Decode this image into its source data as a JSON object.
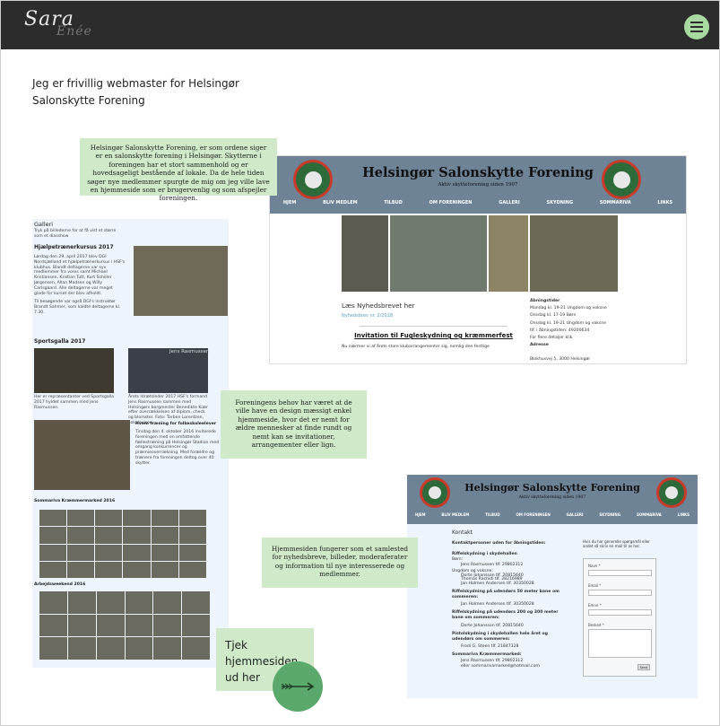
{
  "brand": {
    "logo_text": "Sara",
    "logo_sub": "Enée"
  },
  "intro": {
    "text": "Jeg er frivillig webmaster for Helsingør Salonskytte Forening"
  },
  "notes": {
    "note1": "Helsingør Salonskytte Forening, er som ordene siger er en salonskytte forening i Helsingør. Skytterne i foreningen har et stort sammenhold og er hovedsageligt bestående af lokale. Da de hele tiden søger nye medlemmer spurgte de mig om jeg ville lave en hjemmeside som er brugervenlig og som afspejler foreningen.",
    "note2": "Foreningens behov har været at de ville have en design mæssigt enkel hjemmeside, hvor det er nemt for ældre mennesker at finde rundt og nemt kan se invitationer, arrangementer eller lign.",
    "note3": "Hjemmesiden fungerer som et samlested for nyhedsbreve, billeder, moderaferater og information til nye interesserede og medlemmer."
  },
  "cta": {
    "label": "Tjek hjemmesiden ud her"
  },
  "site": {
    "title": "Helsingør Salonskytte Forening",
    "subtitle": "Aktiv skytteforening siden 1907",
    "nav": [
      "HJEM",
      "BLIV MEDLEM",
      "TILBUD",
      "OM FORENINGEN",
      "GALLERI",
      "SKYDNING",
      "SOMMARIVA",
      "LINKS"
    ]
  },
  "home": {
    "newsletter_heading": "Læs Nyhedsbrevet her",
    "newsletter_link": "Nyhedsbrev nr. 2/2018",
    "invitation_title": "Invitation til Fugleskydning og kræmmerfest",
    "invitation_text": "Nu nærmer vi af årets store klubarrangementer sig, nemlig den festlige",
    "hours": [
      "Åbningstider",
      "Mandag kl. 19-21  Ungdom og voksne",
      "Onsdag  kl. 17-19  Børn",
      "Onsdag  kl. 19-21  Ungdom og voksne",
      "tlf. i åbningstiden: 49200634",
      "For flere detaljer klik",
      "Adresse",
      "Blokhusvej 5, 3000 Helsingør"
    ]
  },
  "gallery": {
    "heading": "Galleri",
    "intro": "Tryk på billederne for at få vist et større som et diasshow",
    "section1": "Hjælpetrænerkursus 2017",
    "section1_text": "Lørdag den 29. april 2017 blev DGI Nordsjælland et hjælpetrænerkursus i HSF's klubhus. Blandt deltagerne var syv medlemmer fra vores samt Michael Kristiansen, Kristian Tutt, Kurt Schiller Jørgensen, Allan Madsen og Willy Carlsgaard. Alle deltagerne var meget glade for kurset der blev afholdt.",
    "section1_text2": "Til besøgende var også DGI's instruktør Brandt Sahmer, som kaldte deltagerne kl. 7.30.",
    "section2": "Sportsgalla 2017",
    "caption_a": "Her er repræsentanter ved Sportsgalla 2017 hyldet sammen med Jens Rasmussen.",
    "caption_b": "Jens Rasmussen",
    "caption_b_text": "Årets Idrætsleder 2017 HSF's formand Jens Rasmussen sammen med Helsingørs borgmester Benedikte Kiær efter overrækkelsen af diplom, check og blomster. Foto: Torben Lorentzen, Lokalavisen.",
    "section3": "Hvem træning for folkeskoleelever",
    "section3_text": "Tirsdag den 4. oktober 2016 inviterede foreningen med en omfattende fællestræning på Helsingør Stadion med et omgang konkurrencer og præmieoverrækning. Med forældre og trænere fra foreningen deltog over 40 skytter.",
    "section4": "Sommariva Kræmmermarked 2016",
    "section5": "Arbejdsweekend 2016"
  },
  "contact": {
    "heading": "Kontakt",
    "people_heading": "Kontaktpersoner uden for åbningstiden:",
    "lines": [
      "Riffelskydning i skydehallen",
      "Børn:",
      "Jens Rasmussen tlf. 29802312",
      "Ungdom og voksne:",
      "Dorte Johansson tlf. 20815640",
      "Thomas Rachidi tlf. 28216989",
      "Jan Holmen Andersen tlf. 30350028",
      "Riffelskydning på udendørs 50 meter bane om sommeren:",
      "Jan Holmen Andersen tlf. 30350028",
      "Riffelskydning på udendørs 200 og 300 meter bane om sommeren:",
      "Dorte Johansson tlf. 20815640",
      "Pistolskydning i skydehallen hele året og udendørs om sommeren:",
      "Frodi G. Steen tlf. 21847328",
      "Sommariva Kræmmermarked:",
      "Jens Rasmussen tlf. 29802312",
      "eller sommarivamarked@hotmail.com"
    ],
    "form_intro": "Hvis du har generelle spørgsmål eller andet så skriv en mail til os her.",
    "form_name": "Navn *",
    "form_email": "Email *",
    "form_subject": "Emne *",
    "form_message": "Besked *",
    "form_submit": "Send"
  },
  "colors": {
    "accent": "#cfe9c9",
    "accent_dark": "#5aa86a",
    "topbar": "#2c2c2c",
    "site_header": "#6f8397"
  }
}
